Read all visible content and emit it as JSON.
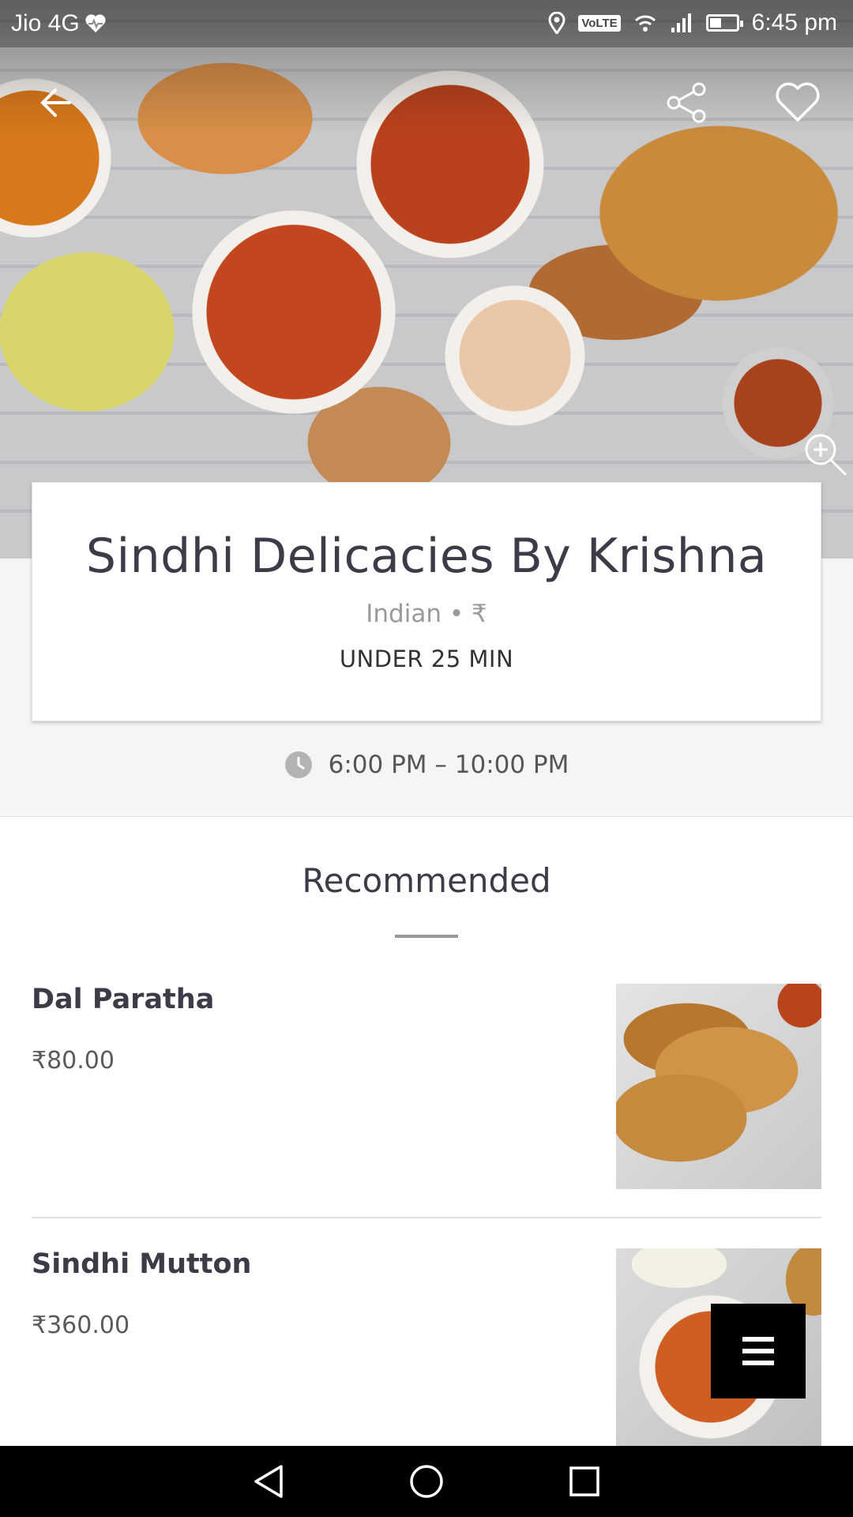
{
  "status_bar": {
    "carrier": "Jio 4G",
    "volte": "VoLTE",
    "time": "6:45 pm",
    "battery_level": 0.45
  },
  "restaurant": {
    "name": "Sindhi Delicacies By Krishna",
    "cuisine_price": "Indian • ₹",
    "eta": "UNDER 25 MIN",
    "hours": "6:00 PM – 10:00 PM"
  },
  "section": {
    "title": "Recommended"
  },
  "items": [
    {
      "name": "Dal Paratha",
      "price": "₹80.00"
    },
    {
      "name": "Sindhi Mutton",
      "price": "₹360.00"
    }
  ],
  "icons": {
    "back": "arrow-left-icon",
    "share": "share-icon",
    "favorite": "heart-icon",
    "zoom": "zoom-in-icon",
    "clock": "clock-icon",
    "menu": "menu-icon"
  },
  "colors": {
    "title_text": "#3c3c48",
    "info_background": "#f5f5f5",
    "fab_background": "#000000"
  }
}
